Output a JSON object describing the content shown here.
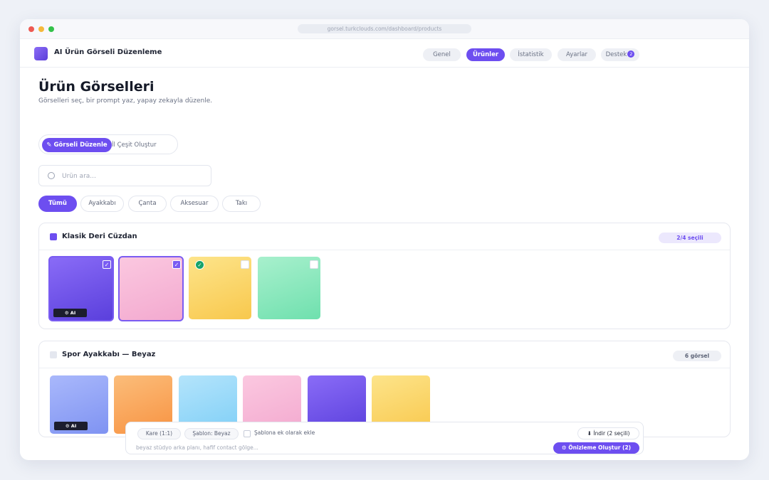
{
  "window": {
    "url": "gorsel.turkclouds.com/dashboard/products"
  },
  "header": {
    "brand": "AI Ürün Görseli Düzenleme",
    "nav": [
      {
        "label": "Genel",
        "active": false
      },
      {
        "label": "Ürünler",
        "active": true
      },
      {
        "label": "İstatistik",
        "active": false
      },
      {
        "label": "Ayarlar",
        "active": false
      },
      {
        "label": "Destek",
        "active": false,
        "badge": "2"
      }
    ]
  },
  "page": {
    "title": "Ürün Görselleri",
    "subtitle": "Görselleri seç, bir prompt yaz, yapay zekayla düzenle."
  },
  "mode": {
    "active_label": "✎ Görseli Düzenle",
    "other_label": "İl Çeşit Oluştur"
  },
  "search": {
    "placeholder": "Ürün ara..."
  },
  "filters": [
    {
      "label": "Tümü",
      "active": true
    },
    {
      "label": "Ayakkabı",
      "active": false
    },
    {
      "label": "Çanta",
      "active": false
    },
    {
      "label": "Aksesuar",
      "active": false
    },
    {
      "label": "Takı",
      "active": false
    }
  ],
  "products": [
    {
      "title": "Klasik Deri Cüzdan",
      "badge": "2/4 seçili",
      "checked": true,
      "images": [
        {
          "colors": [
            "#8a6cf7",
            "#5a3fdc"
          ],
          "selected": true,
          "ai_tag": "⚙ AI",
          "check": "on"
        },
        {
          "colors": [
            "#fbc8e0",
            "#f3a9cf"
          ],
          "selected": true,
          "check": "on"
        },
        {
          "colors": [
            "#fde48a",
            "#f8c84d"
          ],
          "selected": false,
          "check": "off",
          "ok": true
        },
        {
          "colors": [
            "#a8f0cd",
            "#6fe0ae"
          ],
          "selected": false,
          "check": "off"
        }
      ]
    },
    {
      "title": "Spor Ayakkabı — Beyaz",
      "badge": "6 görsel",
      "checked": false,
      "images": [
        {
          "colors": [
            "#a9b8fb",
            "#7f93f2"
          ],
          "ai_tag": "⚙ AI"
        },
        {
          "colors": [
            "#fbbd7a",
            "#f89342"
          ]
        },
        {
          "colors": [
            "#b4e4fb",
            "#7fcff7"
          ]
        },
        {
          "colors": [
            "#fbc8e0",
            "#f3a9cf"
          ]
        },
        {
          "colors": [
            "#8a6cf7",
            "#5a3fdc"
          ]
        },
        {
          "colors": [
            "#fde48a",
            "#f8c84d"
          ]
        }
      ]
    }
  ],
  "bottom_bar": {
    "aspect": "Kare (1:1)",
    "template": "Şablon: Beyaz",
    "add_as_attachment": "Şablona ek olarak ekle",
    "prompt_placeholder": "beyaz stüdyo arka planı, hafif contact gölge...",
    "download_label": "⬇ İndir (2 seçili)",
    "generate_label": "⚙ Önizleme Oluştur (2)"
  },
  "colors": {
    "accent": "#6d4ef0",
    "success": "#16a36b"
  }
}
